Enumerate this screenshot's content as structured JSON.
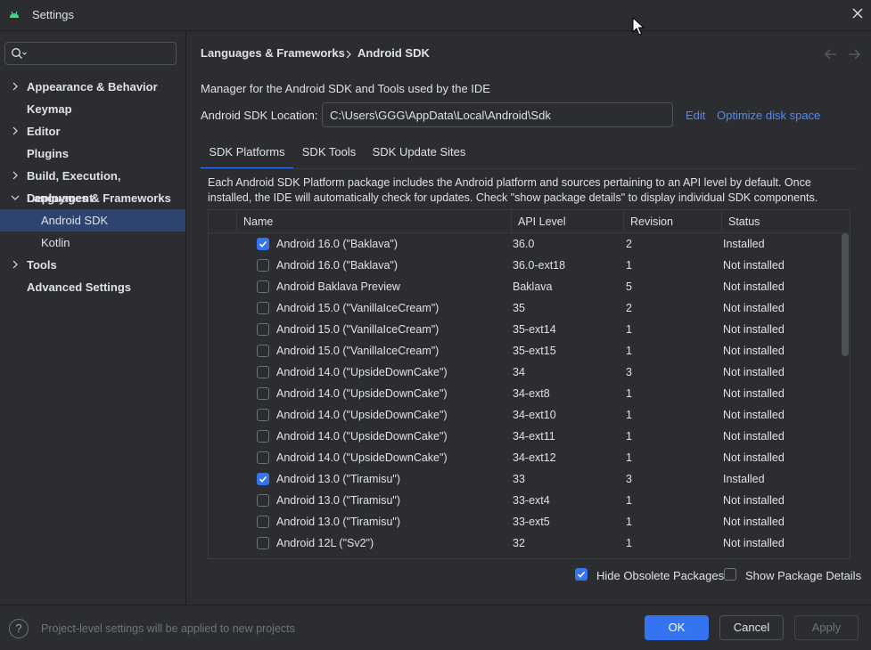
{
  "window": {
    "title": "Settings"
  },
  "search": {
    "placeholder": ""
  },
  "sidebar": {
    "items": [
      {
        "label": "Appearance & Behavior",
        "expandable": true,
        "expanded": false
      },
      {
        "label": "Keymap",
        "expandable": false
      },
      {
        "label": "Editor",
        "expandable": true,
        "expanded": false
      },
      {
        "label": "Plugins",
        "expandable": false
      },
      {
        "label": "Build, Execution, Deployment",
        "expandable": true,
        "expanded": false
      },
      {
        "label": "Languages & Frameworks",
        "expandable": true,
        "expanded": true
      },
      {
        "label": "Android SDK",
        "sub": true,
        "selected": true
      },
      {
        "label": "Kotlin",
        "sub": true
      },
      {
        "label": "Tools",
        "expandable": true,
        "expanded": false
      },
      {
        "label": "Advanced Settings",
        "expandable": false
      }
    ]
  },
  "header": {
    "breadcrumb_parent": "Languages & Frameworks",
    "breadcrumb_current": "Android SDK",
    "back_icon": "arrow-left-icon",
    "forward_icon": "arrow-right-icon"
  },
  "main": {
    "description": "Manager for the Android SDK and Tools used by the IDE",
    "location_label": "Android SDK Location:",
    "location_value": "C:\\Users\\GGG\\AppData\\Local\\Android\\Sdk",
    "edit_link": "Edit",
    "optimize_link": "Optimize disk space",
    "tabs": [
      {
        "label": "SDK Platforms",
        "active": true
      },
      {
        "label": "SDK Tools",
        "active": false
      },
      {
        "label": "SDK Update Sites",
        "active": false
      }
    ],
    "info": "Each Android SDK Platform package includes the Android platform and sources pertaining to an API level by default. Once installed, the IDE will automatically check for updates. Check \"show package details\" to display individual SDK components."
  },
  "table": {
    "columns": [
      "Name",
      "API Level",
      "Revision",
      "Status"
    ],
    "rows": [
      {
        "checked": true,
        "name": "Android 16.0 (\"Baklava\")",
        "api": "36.0",
        "revision": "2",
        "status": "Installed"
      },
      {
        "checked": false,
        "name": "Android 16.0 (\"Baklava\")",
        "api": "36.0-ext18",
        "revision": "1",
        "status": "Not installed"
      },
      {
        "checked": false,
        "name": "Android Baklava Preview",
        "api": "Baklava",
        "revision": "5",
        "status": "Not installed"
      },
      {
        "checked": false,
        "name": "Android 15.0 (\"VanillaIceCream\")",
        "api": "35",
        "revision": "2",
        "status": "Not installed"
      },
      {
        "checked": false,
        "name": "Android 15.0 (\"VanillaIceCream\")",
        "api": "35-ext14",
        "revision": "1",
        "status": "Not installed"
      },
      {
        "checked": false,
        "name": "Android 15.0 (\"VanillaIceCream\")",
        "api": "35-ext15",
        "revision": "1",
        "status": "Not installed"
      },
      {
        "checked": false,
        "name": "Android 14.0 (\"UpsideDownCake\")",
        "api": "34",
        "revision": "3",
        "status": "Not installed"
      },
      {
        "checked": false,
        "name": "Android 14.0 (\"UpsideDownCake\")",
        "api": "34-ext8",
        "revision": "1",
        "status": "Not installed"
      },
      {
        "checked": false,
        "name": "Android 14.0 (\"UpsideDownCake\")",
        "api": "34-ext10",
        "revision": "1",
        "status": "Not installed"
      },
      {
        "checked": false,
        "name": "Android 14.0 (\"UpsideDownCake\")",
        "api": "34-ext11",
        "revision": "1",
        "status": "Not installed"
      },
      {
        "checked": false,
        "name": "Android 14.0 (\"UpsideDownCake\")",
        "api": "34-ext12",
        "revision": "1",
        "status": "Not installed"
      },
      {
        "checked": true,
        "name": "Android 13.0 (\"Tiramisu\")",
        "api": "33",
        "revision": "3",
        "status": "Installed"
      },
      {
        "checked": false,
        "name": "Android 13.0 (\"Tiramisu\")",
        "api": "33-ext4",
        "revision": "1",
        "status": "Not installed"
      },
      {
        "checked": false,
        "name": "Android 13.0 (\"Tiramisu\")",
        "api": "33-ext5",
        "revision": "1",
        "status": "Not installed"
      },
      {
        "checked": false,
        "name": "Android 12L (\"Sv2\")",
        "api": "32",
        "revision": "1",
        "status": "Not installed"
      }
    ]
  },
  "options": {
    "hide_obsolete": {
      "label": "Hide Obsolete Packages",
      "checked": true
    },
    "show_details": {
      "label": "Show Package Details",
      "checked": false
    }
  },
  "footer": {
    "help": "?",
    "note": "Project-level settings will be applied to new projects",
    "ok": "OK",
    "cancel": "Cancel",
    "apply": "Apply"
  },
  "colors": {
    "accent": "#3574f0",
    "link": "#548af7",
    "selected_bg": "#2e436e",
    "background": "#2b2d30"
  }
}
